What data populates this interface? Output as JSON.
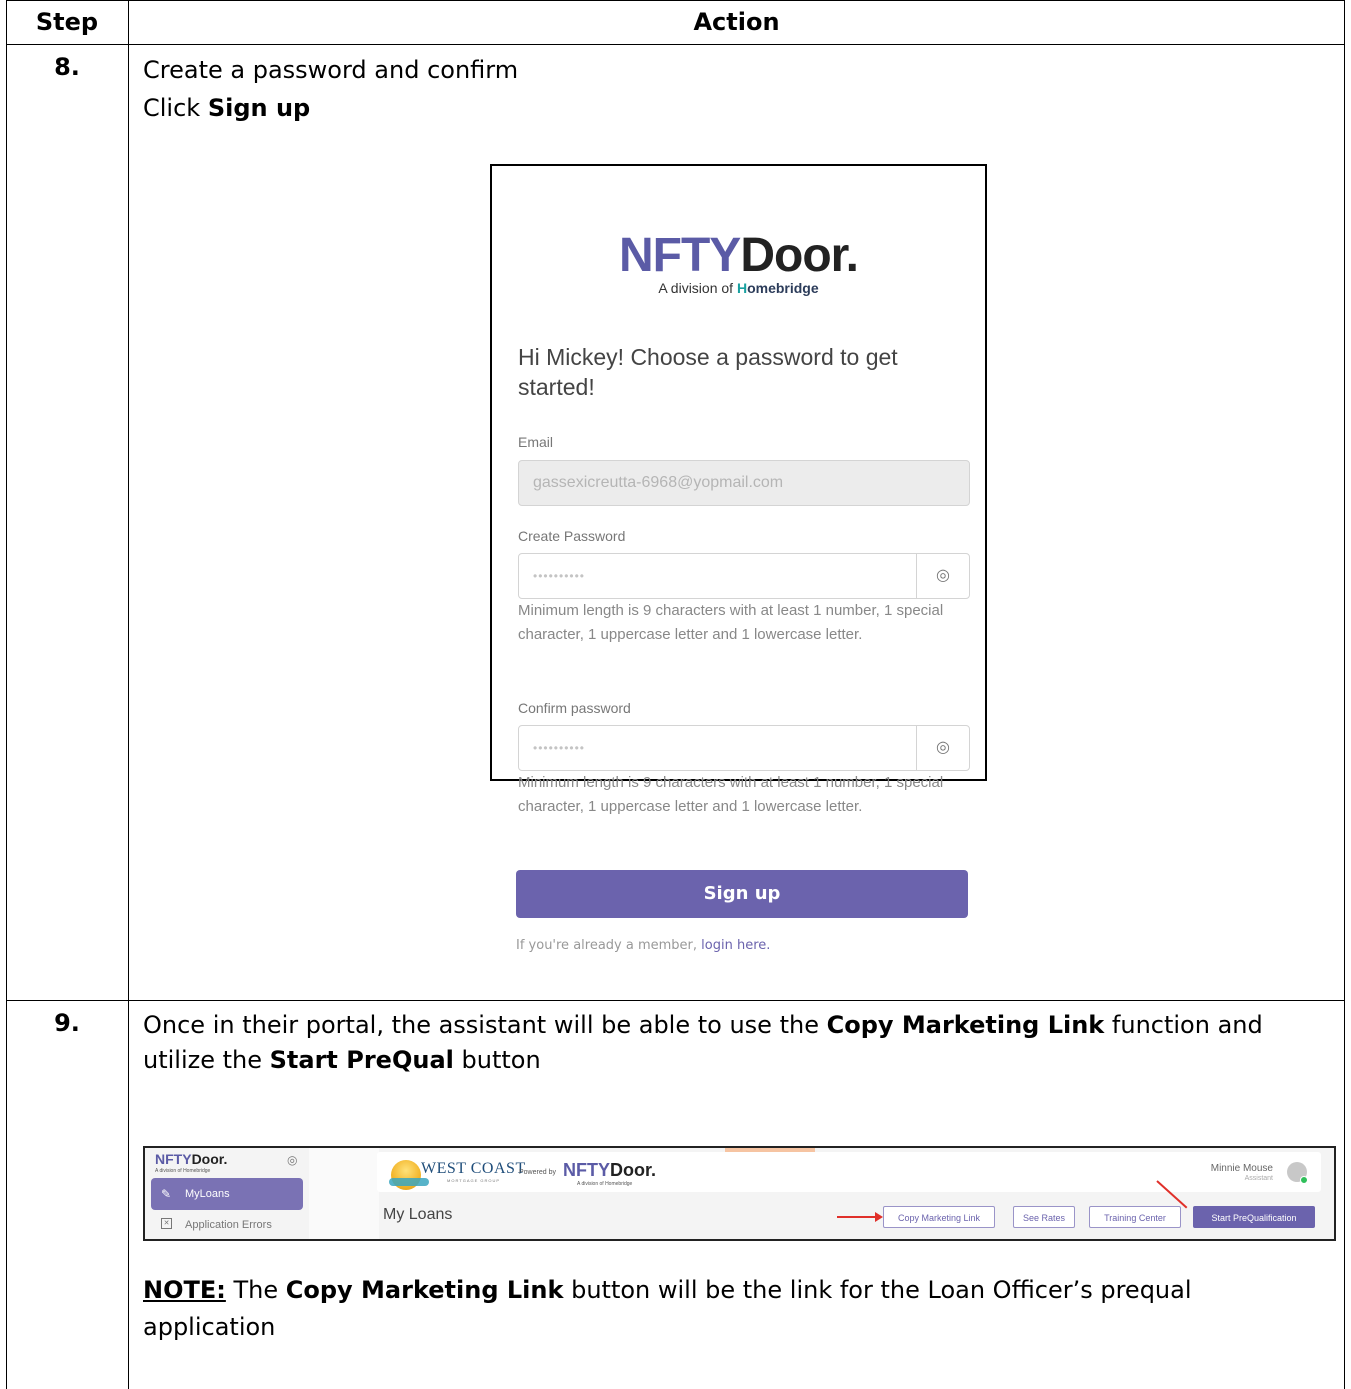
{
  "table": {
    "header_step": "Step",
    "header_action": "Action"
  },
  "step8": {
    "number": "8.",
    "line1": "Create a password and confirm",
    "line2_prefix": "Click ",
    "line2_bold": "Sign up"
  },
  "signup_screen": {
    "logo_nfty": "NFTY",
    "logo_door": "Door.",
    "logo_sub_prefix": "A division of ",
    "logo_sub_h": "H",
    "logo_sub_rest": "omebridge",
    "greeting": "Hi Mickey! Choose a password to get started!",
    "email_label": "Email",
    "email_value": "gassexicreutta-6968@yopmail.com",
    "create_password_label": "Create Password",
    "create_password_value": "••••••••••",
    "create_password_hint": "Minimum length is 9 characters with at least 1 number, 1 special character, 1 uppercase letter and 1 lowercase letter.",
    "confirm_password_label": "Confirm password",
    "confirm_password_value": "••••••••••",
    "confirm_password_hint": "Minimum length is 9 characters with at least 1 number, 1 special character, 1 uppercase letter and 1 lowercase letter.",
    "signup_button": "Sign up",
    "member_text": "If you're already a member, ",
    "login_link": "login here."
  },
  "step9": {
    "number": "9.",
    "line1_prefix": "Once in their portal, the assistant will be able to use the ",
    "line1_bold": "Copy Marketing Link",
    "line1_suffix": " function and",
    "line2_prefix": "utilize the ",
    "line2_bold": "Start PreQual",
    "line2_suffix": " button"
  },
  "portal_screen": {
    "logo_nfty": "NFTY",
    "logo_door": "Door.",
    "logo_sub": "A division of Homebridge",
    "nav_myloans": "MyLoans",
    "nav_app_errors": "Application Errors",
    "brand_text": "WEST COAST",
    "brand_sub": "MORTGAGE GROUP",
    "powered_by": "Powered by",
    "pw_logo_nfty": "NFTY",
    "pw_logo_door": "Door.",
    "pw_logo_sub": "A division of Homebridge",
    "user_name": "Minnie Mouse",
    "user_role": "Assistant",
    "page_title": "My Loans",
    "btn_copy_marketing": "Copy Marketing Link",
    "btn_see_rates": "See Rates",
    "btn_training": "Training Center",
    "btn_start_prequal": "Start PreQualification"
  },
  "note": {
    "label": "NOTE:",
    "text_prefix": " The ",
    "text_bold": "Copy Marketing Link",
    "text_suffix": " button will be the link for the Loan Officer’s prequal",
    "line2": "application"
  }
}
